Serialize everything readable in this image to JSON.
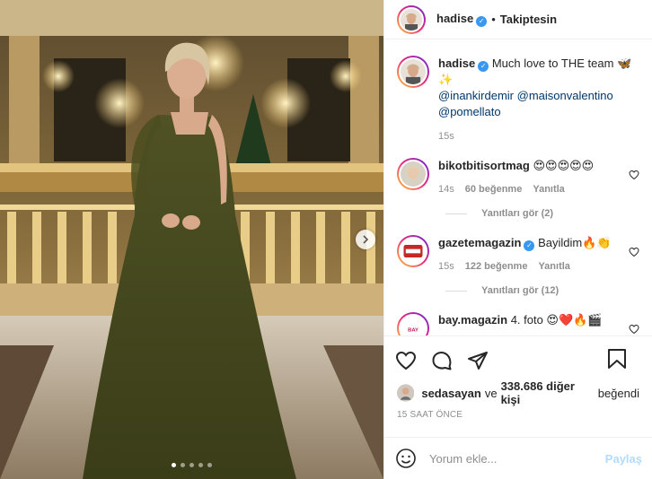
{
  "header": {
    "username": "hadise",
    "separator": "•",
    "follow_label": "Takiptesin"
  },
  "caption": {
    "username": "hadise",
    "text": "Much love to THE team 🦋✨",
    "mentions": [
      "@inankirdemir",
      "@maisonvalentino",
      "@pomellato"
    ],
    "time": "15s"
  },
  "comments": [
    {
      "username": "bikotbitisortmag",
      "text": "😍😍😍😍😍",
      "time": "14s",
      "likes": "60 beğenme",
      "reply_label": "Yanıtla",
      "view_replies": "Yanıtları gör (2)"
    },
    {
      "username": "gazetemagazin",
      "verified": true,
      "text": "Bayildim🔥👏",
      "time": "15s",
      "likes": "122 beğenme",
      "reply_label": "Yanıtla",
      "view_replies": "Yanıtları gör (12)"
    },
    {
      "username": "bay.magazin",
      "text": "4. foto 😍❤️🔥🎬"
    }
  ],
  "likes": {
    "user": "sedasayan",
    "connector": "ve",
    "count": "338.686 diğer kişi",
    "verb": "beğendi"
  },
  "timestamp": "15 SAAT ÖNCE",
  "add_comment": {
    "placeholder": "Yorum ekle...",
    "post_label": "Paylaş"
  },
  "carousel": {
    "total": 5,
    "active_index": 0
  },
  "colors": {
    "verified": "#3897f0",
    "mention": "#00376b",
    "muted": "#8e8e8e",
    "post_disabled": "#b3dbff"
  },
  "icons": [
    "heart-icon",
    "comment-icon",
    "share-icon",
    "bookmark-icon",
    "emoji-icon",
    "chevron-right-icon",
    "verified-badge-icon"
  ]
}
